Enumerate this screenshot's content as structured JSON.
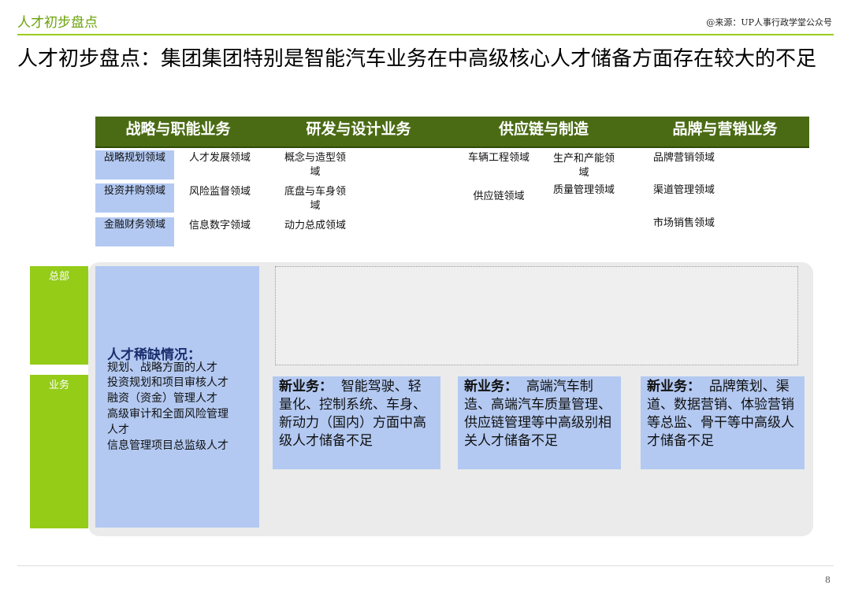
{
  "header": {
    "top_title": "人才初步盘点",
    "source": "@来源：UP人事行政学堂公众号"
  },
  "main_title": "人才初步盘点：集团集团特别是智能汽车业务在中高级核心人才储备方面存在较大的不足",
  "categories": [
    "战略与职能业务",
    "研发与设计业务",
    "供应链与制造",
    "品牌与营销业务"
  ],
  "domains": {
    "strategy_planning": "战略规划领域",
    "investment_ma": "投资并购领域",
    "finance": "金融财务领域",
    "talent_dev": "人才发展领域",
    "risk_monitor": "风险监督领域",
    "info_digital": "信息数字领域",
    "concept_styling": "概念与造型领域",
    "chassis_body": "底盘与车身领域",
    "powertrain": "动力总成领域",
    "vehicle_eng": "车辆工程领域",
    "supply_chain": "供应链领域",
    "production_capacity": "生产和产能领域",
    "quality_mgmt": "质量管理领域",
    "brand_marketing": "品牌营销领域",
    "channel_mgmt": "渠道管理领域",
    "market_sales": "市场销售领域"
  },
  "side_labels": {
    "hq": "总部",
    "business": "业务"
  },
  "talent_shortage": {
    "title": "人才稀缺情况：",
    "lines": [
      "规划、战略方面的人才",
      "投资规划和项目审核人才",
      "融资（资金）管理人才",
      "高级审计和全面风险管理",
      "人才",
      "信息管理项目总监级人才"
    ]
  },
  "new_business": {
    "label": "新业务：",
    "rd": "智能驾驶、轻量化、控制系统、车身、新动力（国内）方面中高级人才储备不足",
    "supply": "高端汽车制造、高端汽车质量管理、供应链管理等中高级别相关人才储备不足",
    "brand": "品牌策划、渠道、数据营销、体验营销等总监、骨干等中高级人才储备不足"
  },
  "page_number": "8",
  "colors": {
    "accent_green": "#94cc18",
    "header_green": "#4a6b14",
    "highlight_blue": "#b3c9f2"
  }
}
